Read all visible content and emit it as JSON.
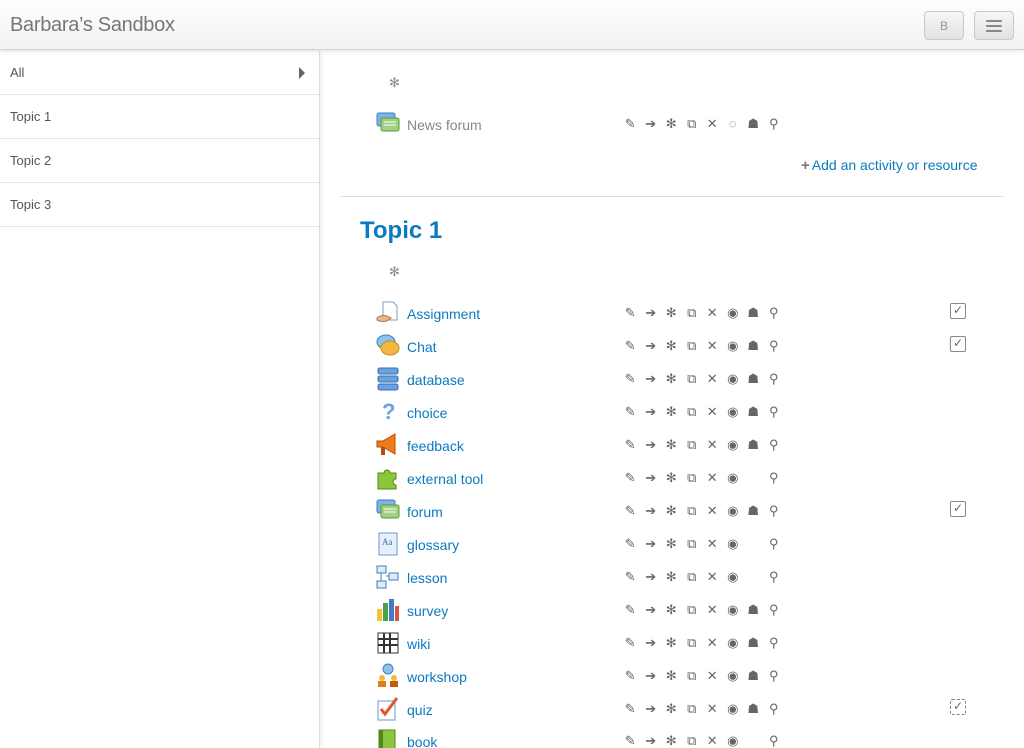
{
  "header": {
    "brand": "Barbara’s Sandbox",
    "user_button": "B"
  },
  "sidebar": {
    "items": [
      {
        "label": "All"
      },
      {
        "label": "Topic 1"
      },
      {
        "label": "Topic 2"
      },
      {
        "label": "Topic 3"
      }
    ]
  },
  "section0": {
    "activities": [
      {
        "name": "News forum",
        "icon": "forum-icon"
      }
    ],
    "add_link": "Add an activity or resource"
  },
  "section1": {
    "title": "Topic 1",
    "activities": [
      {
        "name": "Assignment",
        "icon": "assignment-icon",
        "completion": "manual"
      },
      {
        "name": "Chat",
        "icon": "chat-icon",
        "completion": "manual"
      },
      {
        "name": "database",
        "icon": "database-icon"
      },
      {
        "name": "choice",
        "icon": "choice-icon"
      },
      {
        "name": "feedback",
        "icon": "feedback-icon"
      },
      {
        "name": "external tool",
        "icon": "external-tool-icon"
      },
      {
        "name": "forum",
        "icon": "forum-icon",
        "completion": "manual"
      },
      {
        "name": "glossary",
        "icon": "glossary-icon"
      },
      {
        "name": "lesson",
        "icon": "lesson-icon"
      },
      {
        "name": "survey",
        "icon": "survey-icon"
      },
      {
        "name": "wiki",
        "icon": "wiki-icon"
      },
      {
        "name": "workshop",
        "icon": "workshop-icon"
      },
      {
        "name": "quiz",
        "icon": "quiz-icon",
        "completion": "auto"
      },
      {
        "name": "book",
        "icon": "book-icon"
      }
    ]
  },
  "action_icons": [
    "edit-icon",
    "move-icon",
    "settings-icon",
    "duplicate-icon",
    "delete-icon",
    "hide-icon",
    "groups-icon",
    "assign-roles-icon"
  ],
  "colors": {
    "link": "#0b7ac0",
    "muted": "#888888"
  }
}
